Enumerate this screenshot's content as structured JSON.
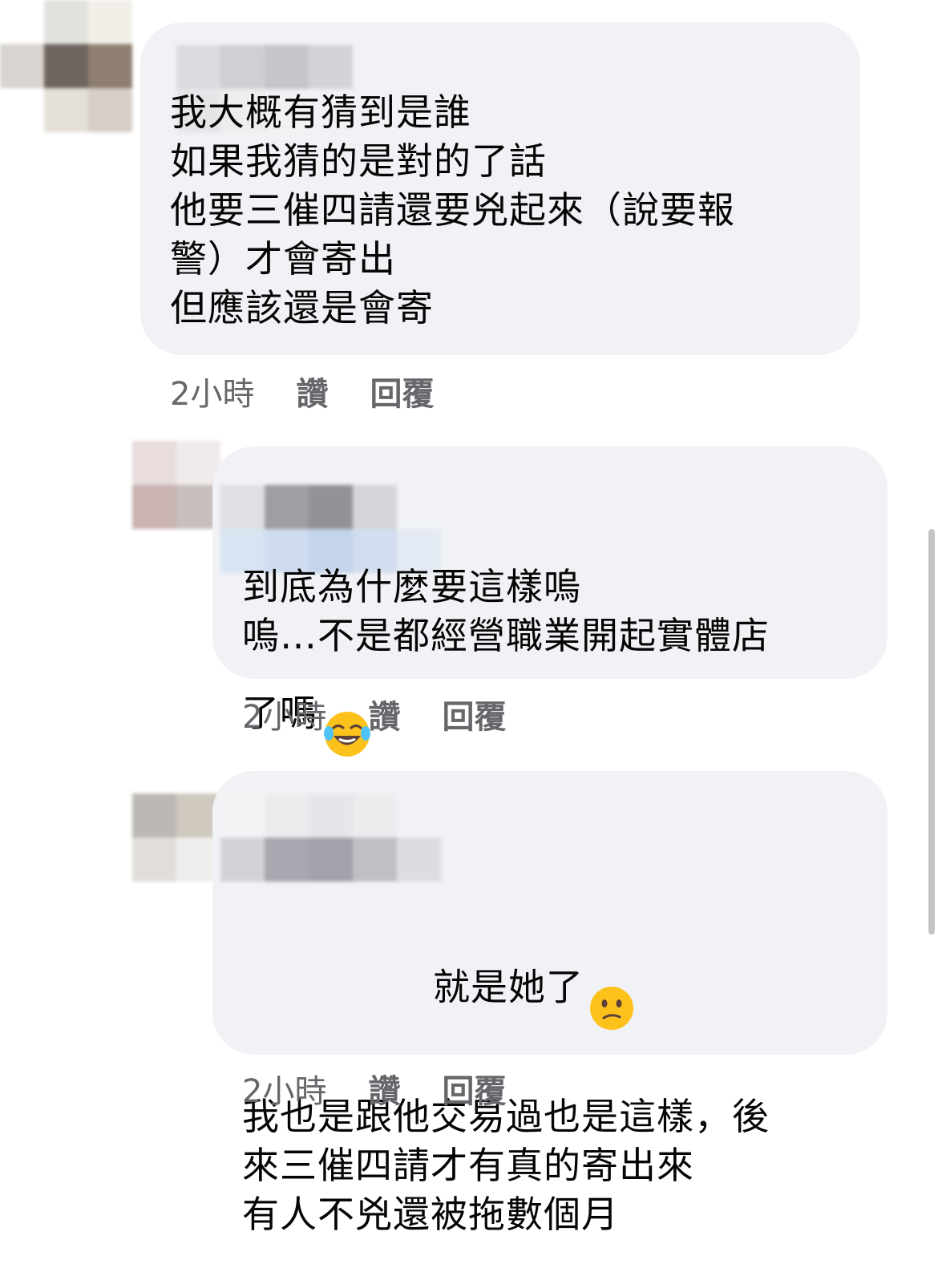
{
  "comments": [
    {
      "text": "我大概有猜到是誰\n如果我猜的是對的了話\n他要三催四請還要兇起來（說要報\n警）才會寄出\n但應該還是會寄",
      "time": "2小時",
      "like": "讚",
      "reply": "回覆"
    },
    {
      "text": "到底為什麼要這樣嗚\n嗚…不是都經營職業開起實體店\n了嗎",
      "emoji": "face-with-tears-of-joy-icon",
      "time": "2小時",
      "like": "讚",
      "reply": "回覆"
    },
    {
      "text_first": "就是她了",
      "emoji": "confused-face-icon",
      "text": "我也是跟他交易過也是這樣，後\n來三催四請才有真的寄出來\n有人不兇還被拖數個月",
      "time": "2小時",
      "like": "讚",
      "reply": "回覆"
    }
  ],
  "colors": {
    "bubble": "#f0f2f5",
    "meta_text": "#65676b",
    "body_text": "#050505"
  }
}
